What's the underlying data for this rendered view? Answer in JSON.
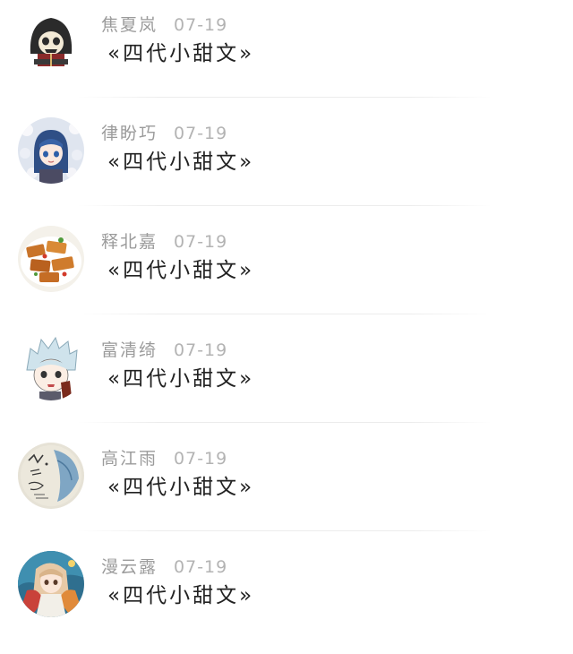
{
  "posts": [
    {
      "name": "焦夏岚",
      "date": "07-19",
      "text": "«四代小甜文»",
      "avatar": "hooded-skull-avatar"
    },
    {
      "name": "律盼巧",
      "date": "07-19",
      "text": "«四代小甜文»",
      "avatar": "anime-girl-blue-hair-avatar"
    },
    {
      "name": "释北嘉",
      "date": "07-19",
      "text": "«四代小甜文»",
      "avatar": "food-dish-avatar"
    },
    {
      "name": "富清绮",
      "date": "07-19",
      "text": "«四代小甜文»",
      "avatar": "anime-boy-silver-hair-avatar"
    },
    {
      "name": "高江雨",
      "date": "07-19",
      "text": "«四代小甜文»",
      "avatar": "handwritten-note-avatar"
    },
    {
      "name": "漫云露",
      "date": "07-19",
      "text": "«四代小甜文»",
      "avatar": "anime-girl-colorful-avatar"
    }
  ]
}
